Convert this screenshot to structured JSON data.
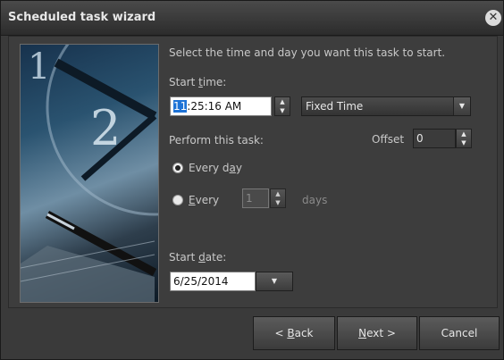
{
  "window": {
    "title": "Scheduled task wizard"
  },
  "instructions": "Select the time and day you want this task to start.",
  "start_time": {
    "label_prefix": "Start ",
    "label_accel": "t",
    "label_suffix": "ime:",
    "hour": "11",
    "rest": ":25:16 AM",
    "mode_value": "Fixed Time"
  },
  "perform": {
    "label": "Perform this task:",
    "offset_label": "Offset",
    "offset_value": "0"
  },
  "schedule": {
    "every_day_prefix": "Every d",
    "every_day_accel": "a",
    "every_day_suffix": "y",
    "every_accel": "E",
    "every_suffix": "very",
    "every_n_value": "1",
    "days_label": "days",
    "selected": "every_day"
  },
  "start_date": {
    "label_prefix": "Start ",
    "label_accel": "d",
    "label_suffix": "ate:",
    "value": "6/25/2014"
  },
  "buttons": {
    "back_prefix": "< ",
    "back_accel": "B",
    "back_suffix": "ack",
    "next_accel": "N",
    "next_suffix": "ext >",
    "cancel": "Cancel"
  },
  "icons": {
    "close": "close-icon",
    "spin_up": "chevron-up-icon",
    "spin_down": "chevron-down-icon",
    "dropdown": "chevron-down-icon"
  }
}
